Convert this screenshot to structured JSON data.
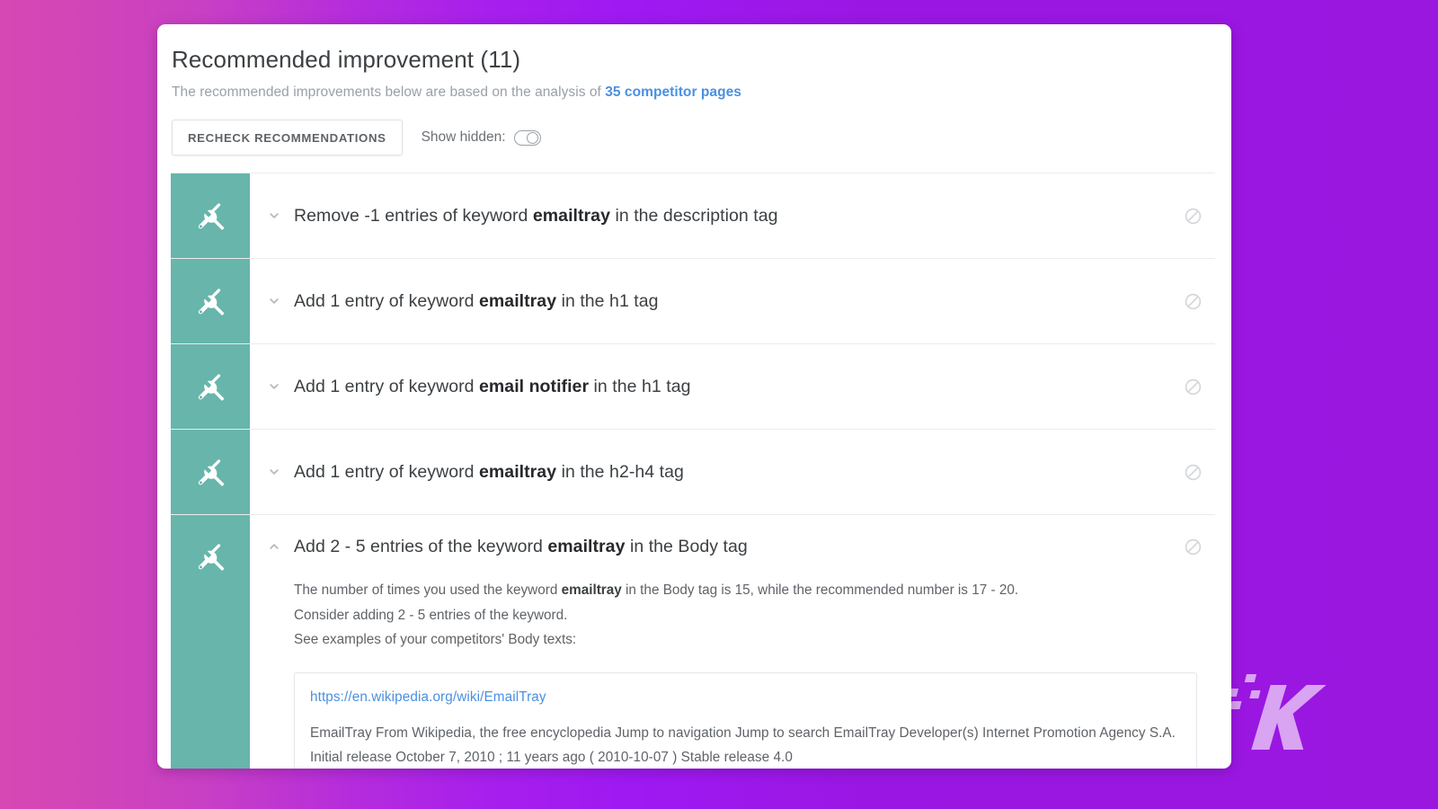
{
  "header": {
    "title": "Recommended improvement (11)",
    "subtitle_prefix": "The recommended improvements below are based on the analysis of ",
    "subtitle_link": "35 competitor pages"
  },
  "toolbar": {
    "recheck_label": "RECHECK RECOMMENDATIONS",
    "show_hidden_label": "Show hidden:",
    "show_hidden_state": "off"
  },
  "colors": {
    "teal_icon_cell": "#67b5ab",
    "link_blue": "#4a90e2",
    "text_primary": "#3c4043",
    "text_muted": "#9aa0a6",
    "bg_gradient_start": "#d648b3",
    "bg_gradient_end": "#9a17e0"
  },
  "icons": {
    "row_icon": "tools-icon",
    "collapse_icon": "chevron-up-icon",
    "expand_icon": "chevron-down-icon",
    "hide_icon": "block-icon"
  },
  "recommendations": [
    {
      "expanded": false,
      "text_before": "Remove -1 entries of keyword ",
      "keyword": "emailtray",
      "text_after": " in the description tag"
    },
    {
      "expanded": false,
      "text_before": "Add 1 entry of keyword ",
      "keyword": "emailtray",
      "text_after": " in the h1 tag"
    },
    {
      "expanded": false,
      "text_before": "Add 1 entry of keyword ",
      "keyword": "email notifier",
      "text_after": " in the h1 tag"
    },
    {
      "expanded": false,
      "text_before": "Add 1 entry of keyword ",
      "keyword": "emailtray",
      "text_after": " in the h2-h4 tag"
    },
    {
      "expanded": true,
      "text_before": "Add 2 - 5 entries of the keyword ",
      "keyword": "emailtray",
      "text_after": " in the Body tag",
      "detail": {
        "line1_before": "The number of times you used the keyword ",
        "line1_keyword": "emailtray",
        "line1_after": " in the Body tag is 15, while the recommended number is 17 - 20.",
        "line2": "Consider adding 2 - 5 entries of the keyword.",
        "line3": "See examples of your competitors' Body texts:",
        "example": {
          "url": "https://en.wikipedia.org/wiki/EmailTray",
          "snippet": "EmailTray From Wikipedia, the free encyclopedia Jump to navigation Jump to search EmailTray Developer(s) Internet Promotion Agency S.A. Initial release October 7, 2010 ; 11 years ago  ( 2010-10-07 ) Stable release 4.0"
        }
      }
    }
  ]
}
